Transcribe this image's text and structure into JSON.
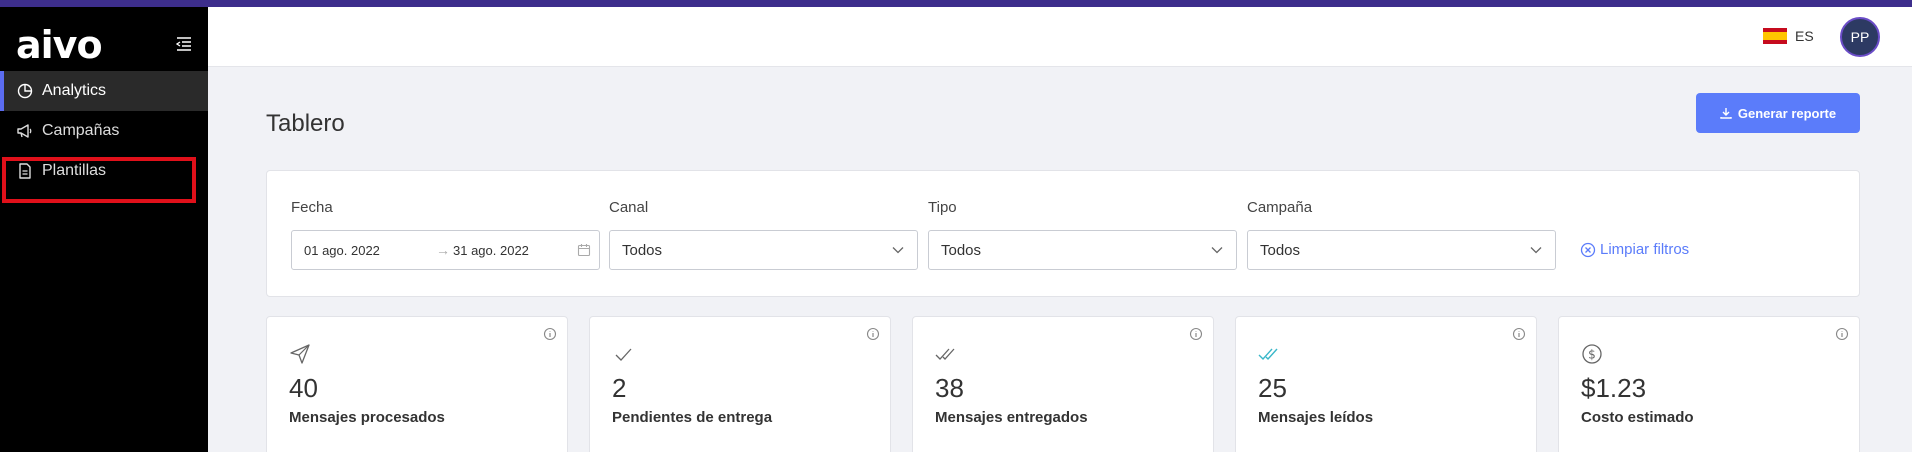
{
  "sidebar": {
    "logo": "aivo",
    "items": [
      {
        "label": "Analytics",
        "icon": "pie-chart-icon"
      },
      {
        "label": "Campañas",
        "icon": "megaphone-icon"
      },
      {
        "label": "Plantillas",
        "icon": "document-icon"
      }
    ]
  },
  "header": {
    "language": "ES",
    "avatar_initials": "PP"
  },
  "page": {
    "title": "Tablero",
    "generate_button": "Generar reporte"
  },
  "filters": {
    "date_label": "Fecha",
    "date_from": "01 ago. 2022",
    "date_to": "31 ago. 2022",
    "channel_label": "Canal",
    "channel_value": "Todos",
    "type_label": "Tipo",
    "type_value": "Todos",
    "campaign_label": "Campaña",
    "campaign_value": "Todos",
    "clear_label": "Limpiar filtros"
  },
  "stats": [
    {
      "value": "40",
      "label": "Mensajes procesados",
      "icon": "send-icon"
    },
    {
      "value": "2",
      "label": "Pendientes de entrega",
      "icon": "check-icon"
    },
    {
      "value": "38",
      "label": "Mensajes entregados",
      "icon": "double-check-icon"
    },
    {
      "value": "25",
      "label": "Mensajes leídos",
      "icon": "double-check-read-icon"
    },
    {
      "value": "$1.23",
      "label": "Costo estimado",
      "icon": "dollar-circle-icon"
    }
  ],
  "colors": {
    "accent": "#5b7cfa",
    "sidebar_bg": "#000000",
    "highlight": "#e0101a",
    "read_check": "#39b7c9"
  }
}
